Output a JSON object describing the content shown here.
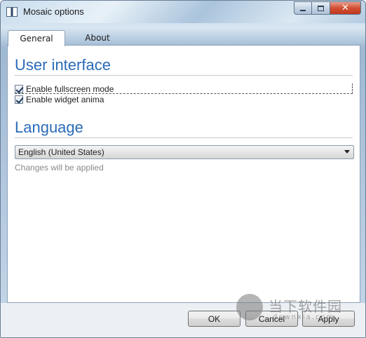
{
  "window": {
    "title": "Mosaic options"
  },
  "tabs": [
    {
      "label": "General",
      "active": true
    },
    {
      "label": "About",
      "active": false
    }
  ],
  "user_interface": {
    "heading": "User interface",
    "options": [
      {
        "label": "Enable fullscreen mode",
        "checked": true
      },
      {
        "label": "Enable widget anima",
        "checked": true
      }
    ]
  },
  "language": {
    "heading": "Language",
    "selected": "English (United States)",
    "hint": "Changes will be applied"
  },
  "buttons": {
    "ok": "OK",
    "cancel": "Cancel",
    "apply": "Apply"
  },
  "watermark": {
    "text": "当下软件园",
    "sub": "downxia.com"
  },
  "colors": {
    "heading": "#2a6bb8",
    "close_button": "#d24e32"
  }
}
